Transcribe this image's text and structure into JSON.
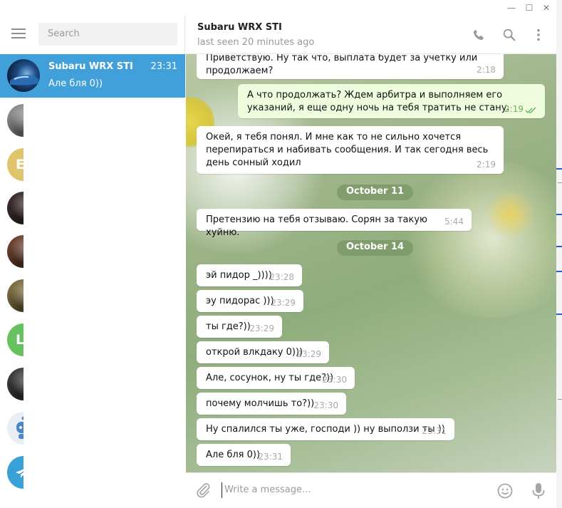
{
  "window": {
    "controls": {
      "minimize": "—",
      "maximize": "☐",
      "close": "✕"
    }
  },
  "sidebar": {
    "search_placeholder": "Search",
    "active_chat": {
      "name": "Subaru WRX STI",
      "time": "23:31",
      "preview": "Але бля 0))"
    },
    "avatars": [
      {
        "letter": "",
        "color": "#8a8a8a",
        "icon": "photo-avatar"
      },
      {
        "letter": "E",
        "color": "#e0c46c",
        "icon": "letter-avatar"
      },
      {
        "letter": "",
        "color": "#3a2a2a",
        "icon": "photo-avatar"
      },
      {
        "letter": "",
        "color": "#6a3f2e",
        "icon": "photo-avatar"
      },
      {
        "letter": "",
        "color": "#7b6a3e",
        "icon": "photo-avatar"
      },
      {
        "letter": "L",
        "color": "#65c25e",
        "icon": "letter-avatar"
      },
      {
        "letter": "",
        "color": "#3a3a3a",
        "icon": "photo-avatar"
      },
      {
        "letter": "",
        "color": "#4b86c7",
        "icon": "bot-avatar"
      },
      {
        "letter": "",
        "color": "#3aa0d8",
        "icon": "telegram-avatar"
      }
    ]
  },
  "chat": {
    "title": "Subaru WRX STI",
    "status": "last seen 20 minutes ago",
    "header_icons": [
      "phone-icon",
      "search-icon",
      "more-vertical-icon"
    ],
    "messages": [
      {
        "dir": "in",
        "text": "Приветствую. Ну так что, выплата будет за учетку или продолжаем?",
        "time": "2:18"
      },
      {
        "dir": "out",
        "text": "А что продолжать? Ждем арбитра и выполняем его указаний, я еще одну ночь на тебя тратить не стану.",
        "time": "2:19"
      },
      {
        "dir": "in",
        "text": "Окей, я тебя понял. И мне как то не сильно хочется перепираться и набивать сообщения. И так сегодня весь день сонный ходил",
        "time": "2:19"
      },
      {
        "dir": "in",
        "text": "Претензию на тебя отзываю. Сорян за такую хуйню.",
        "time": "5:44"
      },
      {
        "dir": "in",
        "text": "эй пидор _))))",
        "time": "23:28"
      },
      {
        "dir": "in",
        "text": "эу пидорас )))",
        "time": "23:29"
      },
      {
        "dir": "in",
        "text": "ты где?))",
        "time": "23:29"
      },
      {
        "dir": "in",
        "text": "открой влкдаку 0)))",
        "time": "23:29"
      },
      {
        "dir": "in",
        "text": "Але, сосунок, ну ты где?))",
        "time": "23:30"
      },
      {
        "dir": "in",
        "text": "почему молчишь то?))",
        "time": "23:30"
      },
      {
        "dir": "in",
        "text": "Ну спалился ты уже, господи )) ну выползи ты ))",
        "time": "23:31"
      },
      {
        "dir": "in",
        "text": "Але бля 0))",
        "time": "23:31"
      }
    ],
    "dates": [
      "October 11",
      "October 14"
    ],
    "composer_placeholder": "Write a message..."
  },
  "colors": {
    "accent": "#419fd9",
    "outgoing_bubble": "#effdde",
    "check": "#6cb55d"
  }
}
